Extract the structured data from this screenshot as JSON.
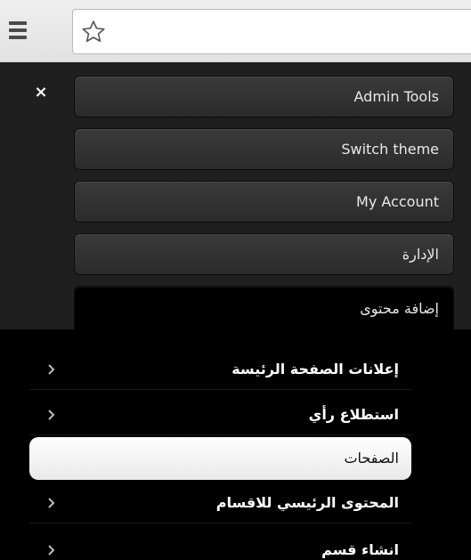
{
  "colors": {
    "toolbar_bg": "#e6e6e6",
    "panel_bg": "#1f1f1f",
    "button_bg": "#333333",
    "submenu_bg": "#000000",
    "selected_bg": "#ffffff"
  },
  "toolbar": {
    "menu_icon": "hamburger-menu-icon",
    "bookmark_icon": "star-outline-icon",
    "url_value": ""
  },
  "panel": {
    "close_label": "×",
    "buttons": [
      {
        "label": "Admin Tools"
      },
      {
        "label": "Switch theme"
      },
      {
        "label": "My Account"
      },
      {
        "label": "الإدارة"
      },
      {
        "label": "إضافة محتوى",
        "active": true
      }
    ]
  },
  "submenu": {
    "items": [
      {
        "label": "إعلانات الصفحة الرئيسة",
        "has_chevron": true,
        "selected": false
      },
      {
        "label": "استطلاع رأي",
        "has_chevron": true,
        "selected": false
      },
      {
        "label": "الصفحات",
        "has_chevron": false,
        "selected": true
      },
      {
        "label": "المحتوى الرئيسي للاقسام",
        "has_chevron": true,
        "selected": false
      },
      {
        "label": "انشاء قسم",
        "has_chevron": true,
        "selected": false
      }
    ]
  }
}
